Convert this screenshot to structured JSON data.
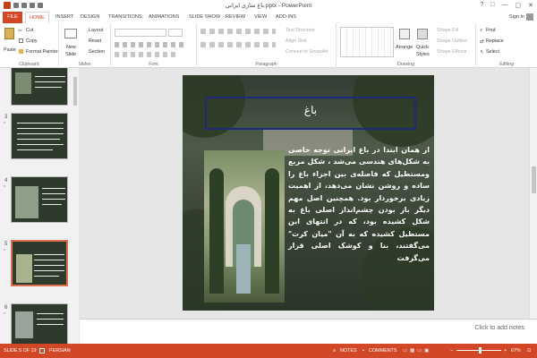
{
  "window": {
    "title": "باغ سازی ایرانی.pptx - PowerPoint",
    "controls": [
      "?",
      "□",
      "—",
      "▢",
      "✕"
    ]
  },
  "tabs": [
    "FILE",
    "HOME",
    "INSERT",
    "DESIGN",
    "TRANSITIONS",
    "ANIMATIONS",
    "SLIDE SHOW",
    "REVIEW",
    "VIEW",
    "ADD-INS"
  ],
  "sign_in": "Sign in",
  "ribbon": {
    "clipboard": {
      "paste": "Paste",
      "cut": "Cut",
      "copy": "Copy",
      "format_painter": "Format Painter",
      "label": "Clipboard"
    },
    "slides": {
      "new_slide": "New",
      "new_slide2": "Slide",
      "layout": "Layout",
      "reset": "Reset",
      "section": "Section",
      "label": "Slides"
    },
    "font": {
      "label": "Font"
    },
    "paragraph": {
      "text_direction": "Text Direction",
      "align_text": "Align Text",
      "convert": "Convert to SmartArt",
      "label": "Paragraph"
    },
    "drawing": {
      "arrange": "Arrange",
      "quick_styles": "Quick",
      "quick_styles2": "Styles",
      "shape_fill": "Shape Fill",
      "shape_outline": "Shape Outline",
      "shape_effects": "Shape Effects",
      "label": "Drawing"
    },
    "editing": {
      "find": "Find",
      "replace": "Replace",
      "select": "Select",
      "label": "Editing"
    }
  },
  "thumbnails": [
    {
      "num": "",
      "selected": false
    },
    {
      "num": "3",
      "selected": false
    },
    {
      "num": "4",
      "selected": false
    },
    {
      "num": "5",
      "selected": true
    },
    {
      "num": "6",
      "selected": false
    }
  ],
  "slide": {
    "title": "باغ",
    "body": "از همان ابتدا در باغ ایرانی توجه خاصی به شکل‌های هندسی می‌شد ، شکل مربع ومستطیل که فاصله‌ی بین اجزاء باغ را ساده و روشن نشان می‌دهد، از اهمیت زیادی برخوردار بود. همچنین اصل مهم دیگر باز بودن چشم‌انداز اصلی باغ به شکل کشیده بود، که در انتهای این مستطیل کشیده که به آن \"میان کرت\" می‌گفتند، بنا و کوشک اصلی قرار می‌گرفت"
  },
  "notes": {
    "placeholder": "Click to add notes"
  },
  "status": {
    "slide_of": "SLIDE 5 OF 19",
    "language": "PERSIAN",
    "notes_btn": "NOTES",
    "comments_btn": "COMMENTS",
    "zoom": "67%"
  },
  "colors": {
    "accent": "#d24726",
    "title_frame": "#1e2a7a"
  }
}
